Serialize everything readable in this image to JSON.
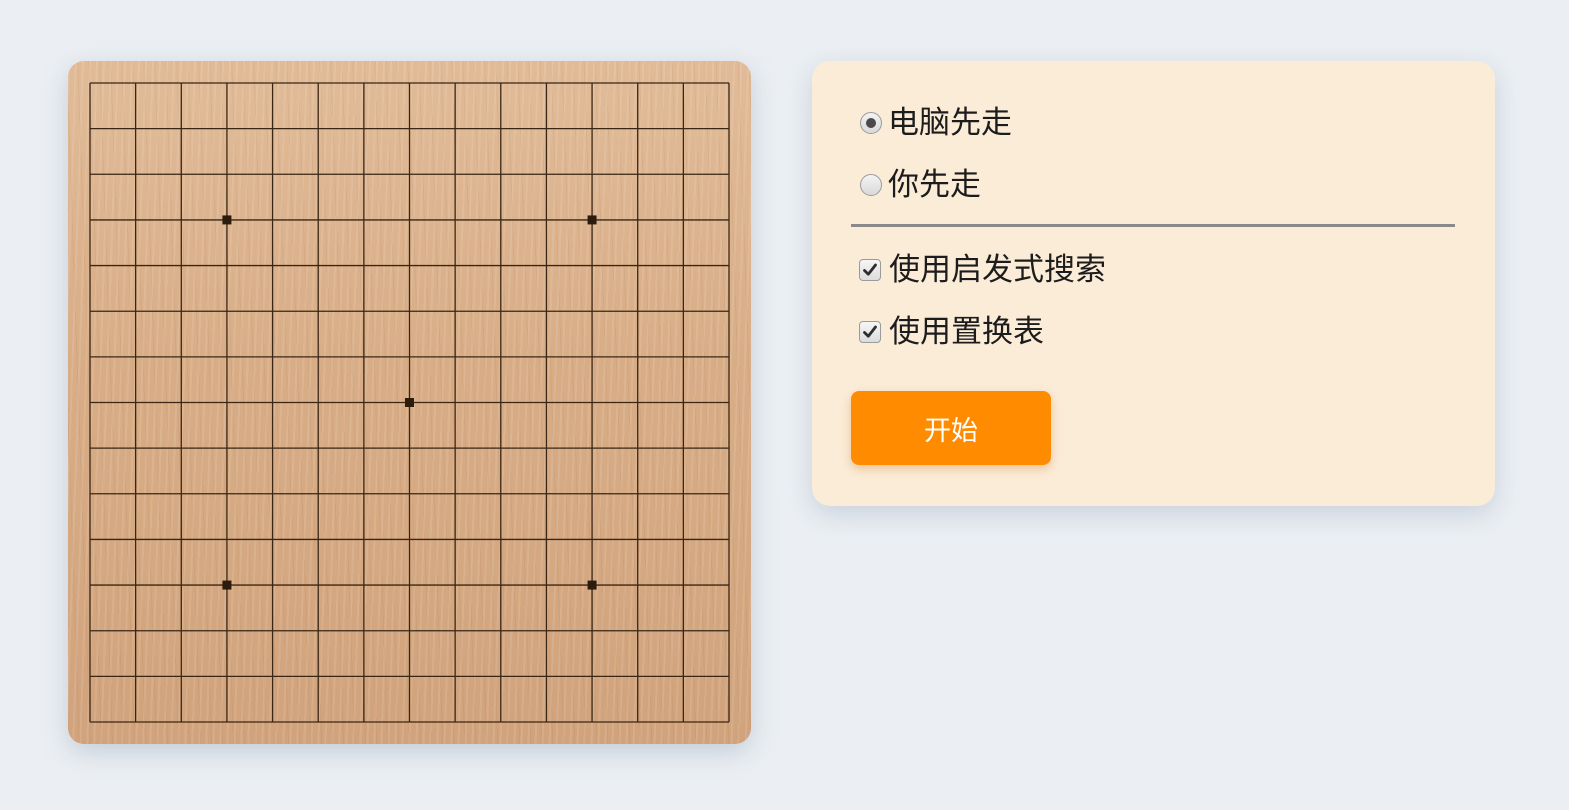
{
  "board": {
    "size": 15,
    "star_points": [
      [
        3,
        3
      ],
      [
        11,
        3
      ],
      [
        7,
        7
      ],
      [
        3,
        11
      ],
      [
        11,
        11
      ]
    ],
    "line_color": "#3a2614",
    "wood_color": "#d9ae88"
  },
  "settings": {
    "first_move": {
      "options": [
        {
          "label": "电脑先走",
          "checked": true
        },
        {
          "label": "你先走",
          "checked": false
        }
      ]
    },
    "search_options": [
      {
        "label": "使用启发式搜索",
        "checked": true
      },
      {
        "label": "使用置换表",
        "checked": true
      }
    ],
    "start_label": "开始",
    "accent_color": "#ff8c00",
    "panel_color": "#fbecd8"
  }
}
